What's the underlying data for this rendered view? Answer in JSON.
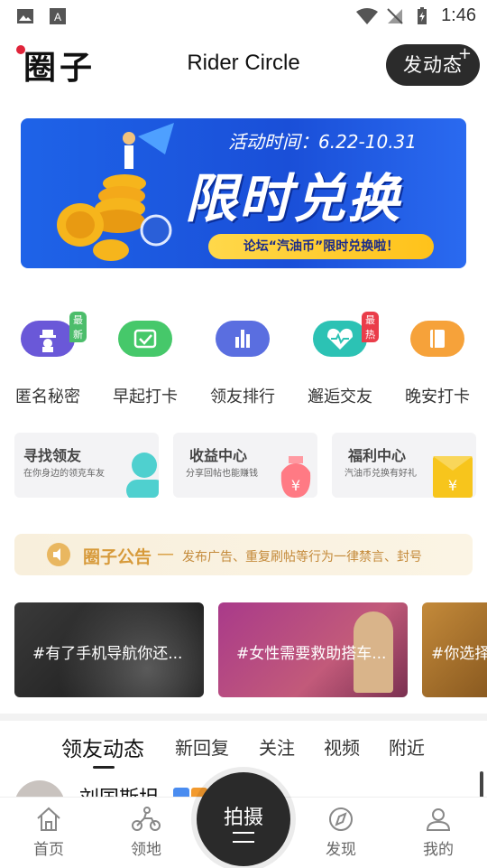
{
  "status_bar": {
    "time": "1:46"
  },
  "header": {
    "logo": "圈子",
    "title": "Rider Circle",
    "post_button": "发动态",
    "post_plus": "+"
  },
  "banner": {
    "period": "活动时间：6.22-10.31",
    "headline": "限时兑换",
    "subtitle": "论坛“汽油币”限时兑换啦！"
  },
  "categories": [
    {
      "label": "匿名秘密",
      "badge": "最新",
      "color": "#6a58d8"
    },
    {
      "label": "早起打卡",
      "badge": "",
      "color": "#46c86a"
    },
    {
      "label": "领友排行",
      "badge": "",
      "color": "#5a6ee0"
    },
    {
      "label": "邂逅交友",
      "badge": "最热",
      "color": "#2cc2b4"
    },
    {
      "label": "晚安打卡",
      "badge": "",
      "color": "#f6a23a"
    }
  ],
  "cards": [
    {
      "title": "寻找领友",
      "subtitle": "在你身边的领克车友"
    },
    {
      "title": "收益中心",
      "subtitle": "分享回帖也能赚钱"
    },
    {
      "title": "福利中心",
      "subtitle": "汽油币兑换有好礼"
    }
  ],
  "notice": {
    "title": "圈子公告",
    "dash": "—",
    "text": "发布广告、重复刷帖等行为一律禁言、封号"
  },
  "topics": [
    {
      "label": "#有了手机导航你还..."
    },
    {
      "label": "#女性需要救助搭车..."
    },
    {
      "label": "#你选择"
    }
  ],
  "tabs": [
    "领友动态",
    "新回复",
    "关注",
    "视频",
    "附近"
  ],
  "feed": {
    "author": "刘国斯坦"
  },
  "nav": {
    "home": "首页",
    "territory": "领地",
    "shoot": "拍摄",
    "discover": "发现",
    "mine": "我的"
  },
  "colors": {
    "accent_blue": "#1e63e8",
    "dark_button": "#2b2b2b",
    "notice_gold": "#d79a3a"
  }
}
